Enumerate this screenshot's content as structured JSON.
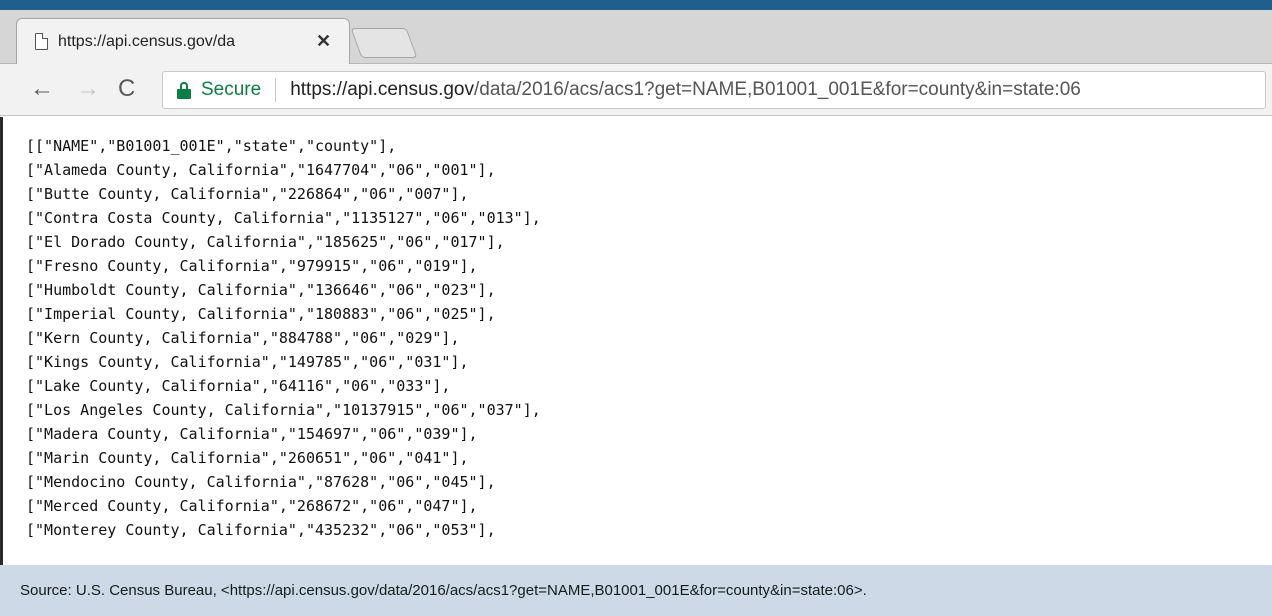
{
  "browser": {
    "tab": {
      "title": "https://api.census.gov/da",
      "close_glyph": "✕"
    },
    "toolbar": {
      "back_glyph": "←",
      "forward_glyph": "→",
      "reload_glyph": "C",
      "secure_label": "Secure",
      "url_host": "https://api.census.gov",
      "url_path": "/data/2016/acs/acs1?get=NAME,B01001_001E&for=county&in=state:06"
    }
  },
  "response": {
    "lines": [
      "[[\"NAME\",\"B01001_001E\",\"state\",\"county\"],",
      "[\"Alameda County, California\",\"1647704\",\"06\",\"001\"],",
      "[\"Butte County, California\",\"226864\",\"06\",\"007\"],",
      "[\"Contra Costa County, California\",\"1135127\",\"06\",\"013\"],",
      "[\"El Dorado County, California\",\"185625\",\"06\",\"017\"],",
      "[\"Fresno County, California\",\"979915\",\"06\",\"019\"],",
      "[\"Humboldt County, California\",\"136646\",\"06\",\"023\"],",
      "[\"Imperial County, California\",\"180883\",\"06\",\"025\"],",
      "[\"Kern County, California\",\"884788\",\"06\",\"029\"],",
      "[\"Kings County, California\",\"149785\",\"06\",\"031\"],",
      "[\"Lake County, California\",\"64116\",\"06\",\"033\"],",
      "[\"Los Angeles County, California\",\"10137915\",\"06\",\"037\"],",
      "[\"Madera County, California\",\"154697\",\"06\",\"039\"],",
      "[\"Marin County, California\",\"260651\",\"06\",\"041\"],",
      "[\"Mendocino County, California\",\"87628\",\"06\",\"045\"],",
      "[\"Merced County, California\",\"268672\",\"06\",\"047\"],",
      "[\"Monterey County, California\",\"435232\",\"06\",\"053\"],"
    ]
  },
  "caption": {
    "source": "Source: U.S. Census Bureau, <https://api.census.gov/data/2016/acs/acs1?get=NAME,B01001_001E&for=county&in=state:06>."
  },
  "colors": {
    "top_band": "#1f5f8b",
    "secure_green": "#0b8043",
    "caption_bg": "#cdd9e6"
  }
}
